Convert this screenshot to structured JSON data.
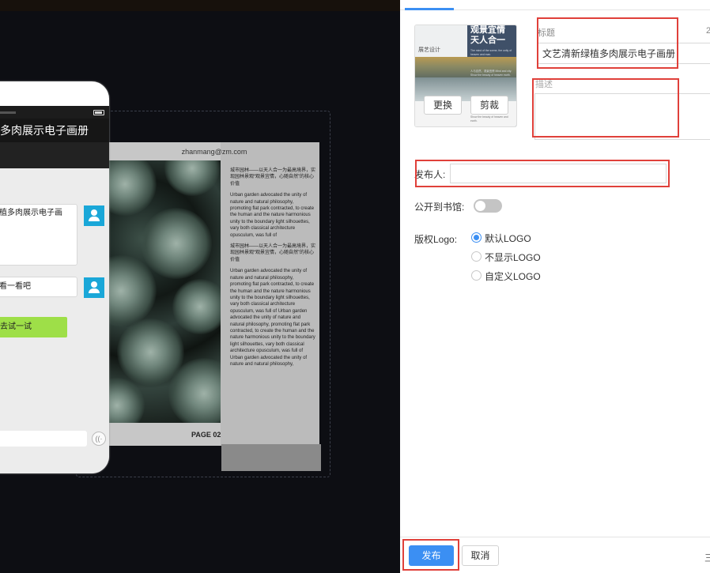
{
  "editor": {
    "page": {
      "email": "zhanmang@zm.com",
      "page_label": "PAGE 02",
      "paragraphs": [
        "城市园林——以天人合一为最高境界，实现园林景观“观景宜情，心随自然”的核心价值",
        "Urban garden advocated the unity of nature and natural philosophy, promoting flat park contracted, to create the human and the nature harmonious unity to the boundary light silhouettes, vary both classical architecture opusculum, was full of",
        "城市园林——以天人合一为最高境界，实现园林景观“观景宜情，心随自然”的核心价值",
        "Urban garden advocated the unity of nature and natural philosophy, promoting flat park contracted, to create the human and the nature harmonious unity to the boundary light silhouettes, vary both classical architecture opusculum, was full of Urban garden advocated the unity of nature and natural philosophy, promoting flat park contracted, to create the human and the nature harmonious unity to the boundary light silhouettes, vary both classical architecture opusculum, was full of",
        "Urban garden advocated the unity of nature and natural philosophy,"
      ]
    },
    "phone": {
      "title": "多肉展示电子画册",
      "bubble1": "植多肉展示电子画",
      "bubble2": "看一看吧",
      "green_button": "去试一试",
      "voice_icon_glyph": "((·"
    }
  },
  "panel": {
    "cover": {
      "design_text": "展艺设计",
      "big_title": "观景宜情 天人合一",
      "mini_text": "The mind of the scene, the unity of heaven and man.",
      "mini_text2": "人与自然，观景宜情 Mind and city. Show the beauty of heaven earth.",
      "bottom_text": "Show the beauty of heaven and earth.",
      "replace_label": "更换",
      "crop_label": "剪裁"
    },
    "title_label": "标题",
    "title_count": "2",
    "title_value": "文艺清新绿植多肉展示电子画册",
    "description_label": "描述",
    "description_value": "",
    "publisher_label": "发布人:",
    "publisher_value": "",
    "library_label": "公开到书馆:",
    "library_enabled": false,
    "logo_label": "版权Logo:",
    "logo_options": [
      {
        "label": "默认LOGO",
        "checked": true
      },
      {
        "label": "不显示LOGO",
        "checked": false
      },
      {
        "label": "自定义LOGO",
        "checked": false
      }
    ],
    "publish_label": "发布",
    "cancel_label": "取消",
    "footer_edge_text": "三"
  },
  "colors": {
    "accent": "#3b8ff3",
    "highlight_red": "#e0403a",
    "avatar_blue": "#1aa7d8",
    "cta_green": "#9edf48"
  }
}
